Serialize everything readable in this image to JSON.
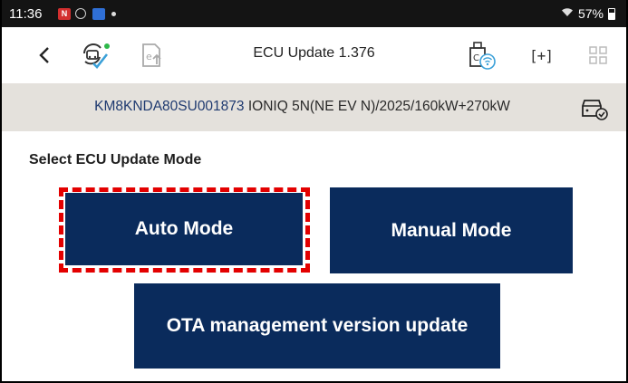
{
  "status_bar": {
    "time": "11:36",
    "calendar_badge": "N",
    "battery": "57%"
  },
  "toolbar": {
    "title": "ECU Update 1.376",
    "back_glyph": "‹",
    "scan_glyph": "[+]",
    "icons": [
      "back-icon",
      "vehicle-sync-icon",
      "export-icon",
      "vci-wifi-icon",
      "scan-icon",
      "grid-icon"
    ]
  },
  "vehicle": {
    "vin": "KM8KNDA80SU001873",
    "description": "IONIQ 5N(NE EV N)/2025/160kW+270kW"
  },
  "main": {
    "heading": "Select ECU Update Mode",
    "auto_label": "Auto Mode",
    "manual_label": "Manual Mode",
    "ota_label": "OTA management version update"
  },
  "colors": {
    "primary_button": "#0a2b5c",
    "highlight": "#e30000",
    "info_bar": "#e4e1dc",
    "status_bar": "#141414"
  }
}
